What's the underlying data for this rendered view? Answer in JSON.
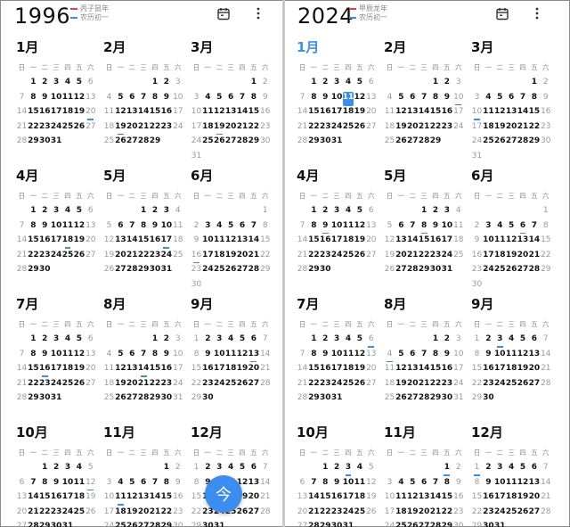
{
  "weekday_labels": [
    "日",
    "一",
    "二",
    "三",
    "四",
    "五",
    "六"
  ],
  "accent_color": "#3b8ef0",
  "panels": [
    {
      "year": "1996",
      "legend": [
        {
          "label": "丙子鼠年",
          "color": "#e04040"
        },
        {
          "label": "农历初一",
          "color": "#3b8ef0"
        }
      ],
      "months": [
        {
          "title": "1月",
          "offset": 1,
          "days": 31,
          "blue": [
            20
          ],
          "red": []
        },
        {
          "title": "2月",
          "offset": 4,
          "days": 29,
          "blue": [],
          "red": [
            19
          ]
        },
        {
          "title": "3月",
          "offset": 5,
          "days": 31,
          "blue": [
            19
          ],
          "red": []
        },
        {
          "title": "4月",
          "offset": 1,
          "days": 30,
          "blue": [
            18
          ],
          "red": []
        },
        {
          "title": "5月",
          "offset": 3,
          "days": 31,
          "blue": [
            17
          ],
          "red": []
        },
        {
          "title": "6月",
          "offset": 6,
          "days": 30,
          "blue": [
            16
          ],
          "red": []
        },
        {
          "title": "7月",
          "offset": 1,
          "days": 31,
          "blue": [
            16
          ],
          "red": []
        },
        {
          "title": "8月",
          "offset": 4,
          "days": 31,
          "blue": [
            14
          ],
          "red": []
        },
        {
          "title": "9月",
          "offset": 0,
          "days": 30,
          "blue": [
            13
          ],
          "red": []
        },
        {
          "title": "10月",
          "offset": 2,
          "days": 31,
          "blue": [
            12
          ],
          "red": []
        },
        {
          "title": "11月",
          "offset": 5,
          "days": 30,
          "blue": [
            11
          ],
          "red": []
        },
        {
          "title": "12月",
          "offset": 0,
          "days": 31,
          "blue": [
            11
          ],
          "red": []
        }
      ]
    },
    {
      "year": "2024",
      "legend": [
        {
          "label": "甲辰龙年",
          "color": "#e04040"
        },
        {
          "label": "农历初一",
          "color": "#3b8ef0"
        }
      ],
      "months": [
        {
          "title": "1月",
          "offset": 1,
          "days": 31,
          "blue": [],
          "red": [],
          "current": true,
          "today": 11
        },
        {
          "title": "2月",
          "offset": 4,
          "days": 29,
          "blue": [],
          "red": [
            10
          ]
        },
        {
          "title": "3月",
          "offset": 5,
          "days": 31,
          "blue": [
            10
          ],
          "red": []
        },
        {
          "title": "4月",
          "offset": 1,
          "days": 30,
          "blue": [
            9
          ],
          "red": []
        },
        {
          "title": "5月",
          "offset": 3,
          "days": 31,
          "blue": [
            8
          ],
          "red": []
        },
        {
          "title": "6月",
          "offset": 6,
          "days": 30,
          "blue": [
            6
          ],
          "red": []
        },
        {
          "title": "7月",
          "offset": 1,
          "days": 31,
          "blue": [
            6
          ],
          "red": []
        },
        {
          "title": "8月",
          "offset": 4,
          "days": 31,
          "blue": [
            4
          ],
          "red": []
        },
        {
          "title": "9月",
          "offset": 0,
          "days": 30,
          "blue": [
            3
          ],
          "red": []
        },
        {
          "title": "10月",
          "offset": 2,
          "days": 31,
          "blue": [
            3
          ],
          "red": []
        },
        {
          "title": "11月",
          "offset": 5,
          "days": 30,
          "blue": [
            1
          ],
          "red": []
        },
        {
          "title": "12月",
          "offset": 0,
          "days": 31,
          "blue": [
            1
          ],
          "red": []
        }
      ]
    }
  ],
  "toolbar": {
    "calendar_icon": "calendar-icon",
    "more_icon": "more-vertical-icon"
  },
  "fab": {
    "label": "今"
  }
}
